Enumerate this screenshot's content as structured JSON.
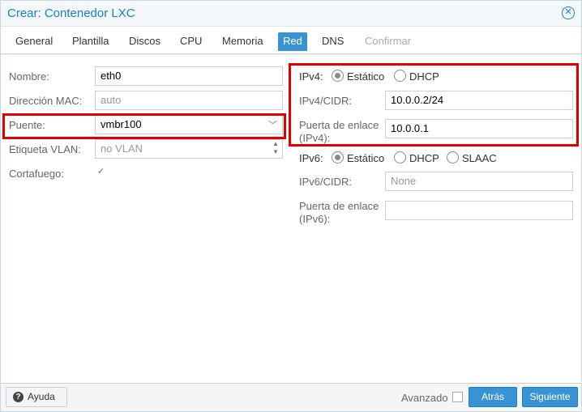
{
  "window": {
    "title": "Crear: Contenedor LXC",
    "close_icon": "close-circle-icon"
  },
  "tabs": [
    {
      "label": "General"
    },
    {
      "label": "Plantilla"
    },
    {
      "label": "Discos"
    },
    {
      "label": "CPU"
    },
    {
      "label": "Memoria"
    },
    {
      "label": "Red",
      "active": true
    },
    {
      "label": "DNS"
    },
    {
      "label": "Confirmar",
      "disabled": true
    }
  ],
  "left": {
    "name_label": "Nombre:",
    "name_value": "eth0",
    "mac_label": "Dirección MAC:",
    "mac_value": "auto",
    "bridge_label": "Puente:",
    "bridge_value": "vmbr100",
    "vlan_label": "Etiqueta VLAN:",
    "vlan_value": "no VLAN",
    "firewall_label": "Cortafuego:",
    "firewall_checked": true
  },
  "right": {
    "ipv4_label": "IPv4:",
    "ipv4_static": "Estático",
    "ipv4_dhcp": "DHCP",
    "ipv4_mode": "Estático",
    "ipv4_cidr_label": "IPv4/CIDR:",
    "ipv4_cidr_value": "10.0.0.2/24",
    "gw4_label_1": "Puerta de enlace",
    "gw4_label_2": "(IPv4):",
    "gw4_value": "10.0.0.1",
    "ipv6_label": "IPv6:",
    "ipv6_static": "Estático",
    "ipv6_dhcp": "DHCP",
    "ipv6_slaac": "SLAAC",
    "ipv6_mode": "Estático",
    "ipv6_cidr_label": "IPv6/CIDR:",
    "ipv6_cidr_value": "None",
    "gw6_label_1": "Puerta de enlace",
    "gw6_label_2": "(IPv6):",
    "gw6_value": ""
  },
  "footer": {
    "help_label": "Ayuda",
    "advanced_label": "Avanzado",
    "advanced_checked": false,
    "back_label": "Atrás",
    "next_label": "Siguiente"
  },
  "colors": {
    "accent": "#157fcc",
    "active_tab": "#3892d4",
    "highlight": "#e10000"
  }
}
